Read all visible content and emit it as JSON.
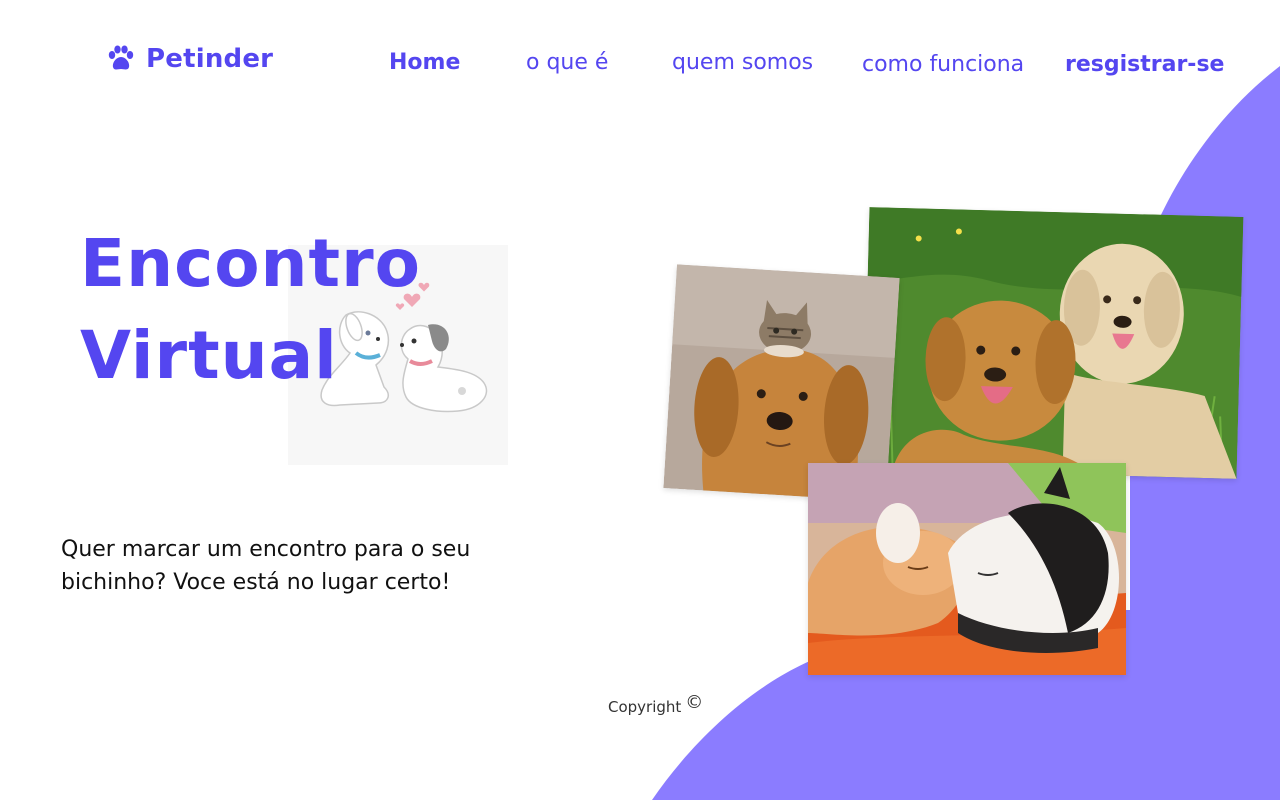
{
  "brand": {
    "name": "Petinder",
    "icon": "paw-icon",
    "accent_color": "#5446f0",
    "shape_color": "#8b7cff"
  },
  "nav": {
    "items": [
      {
        "label": "Home"
      },
      {
        "label": "o que é"
      },
      {
        "label": "quem somos"
      },
      {
        "label": "como funciona"
      },
      {
        "label": "resgistrar-se"
      }
    ]
  },
  "hero": {
    "title_line1": "Encontro",
    "title_line2": "Virtual",
    "description": "Quer marcar um encontro para o seu bichinho? Voce está no lugar certo!",
    "illustration": "cartoon-dogs-illustration"
  },
  "gallery": {
    "photos": [
      {
        "subject": "two-golden-retrievers-in-grass"
      },
      {
        "subject": "kitten-on-dog-head"
      },
      {
        "subject": "two-cats-hugging"
      }
    ]
  },
  "footer": {
    "copyright_label": "Copyright",
    "copyright_symbol": "©"
  }
}
